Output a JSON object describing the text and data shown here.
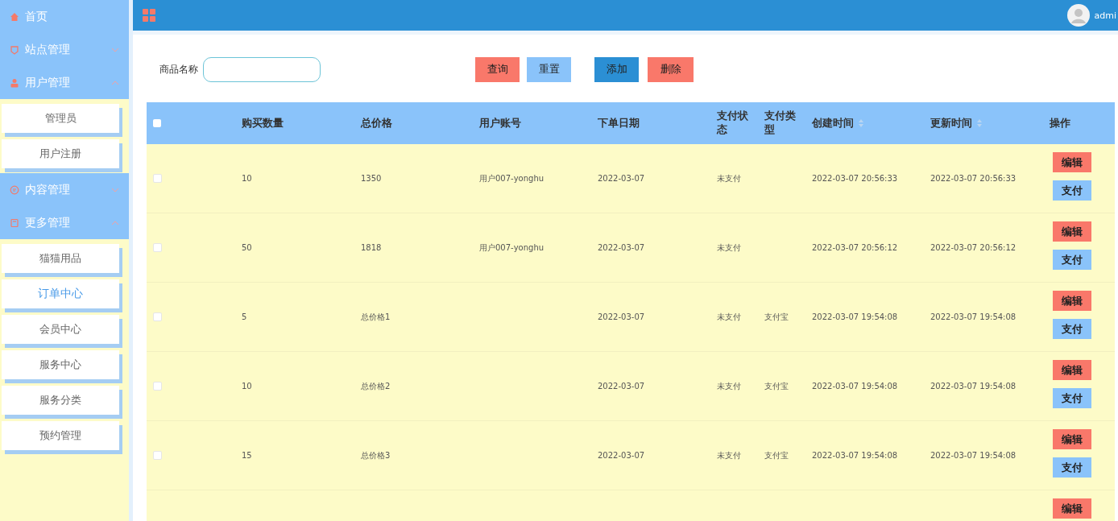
{
  "sidebar": {
    "items": [
      {
        "label": "首页"
      },
      {
        "label": "站点管理",
        "expanded": false
      },
      {
        "label": "用户管理",
        "expanded": true,
        "children": [
          {
            "label": "管理员",
            "selected": false
          },
          {
            "label": "用户注册",
            "selected": false
          }
        ]
      },
      {
        "label": "内容管理",
        "expanded": false
      },
      {
        "label": "更多管理",
        "expanded": true,
        "children": [
          {
            "label": "猫猫用品",
            "selected": false
          },
          {
            "label": "订单中心",
            "selected": true
          },
          {
            "label": "会员中心",
            "selected": false
          },
          {
            "label": "服务中心",
            "selected": false
          },
          {
            "label": "服务分类",
            "selected": false
          },
          {
            "label": "预约管理",
            "selected": false
          }
        ]
      }
    ]
  },
  "topbar": {
    "user": "admi"
  },
  "search": {
    "label": "商品名称",
    "buttons": [
      {
        "label": "查询",
        "kind": "query"
      },
      {
        "label": "重置",
        "kind": "reset"
      },
      {
        "label": "添加",
        "kind": "add"
      },
      {
        "label": "删除",
        "kind": "delete"
      }
    ]
  },
  "table": {
    "all_checked": false,
    "columns": [
      {
        "label": "购买数量"
      },
      {
        "label": "总价格"
      },
      {
        "label": "用户账号"
      },
      {
        "label": "下单日期"
      },
      {
        "label": "支付状态"
      },
      {
        "label": "支付类型"
      },
      {
        "label": "创建时间",
        "sortable": true
      },
      {
        "label": "更新时间",
        "sortable": true
      },
      {
        "label": "操作"
      }
    ],
    "rows": [
      {
        "checked": false,
        "cells": [
          "10",
          "1350",
          "用户007-yonghu",
          "2022-03-07",
          "未支付",
          "",
          "2022-03-07 20:56:33",
          "2022-03-07 20:56:33"
        ],
        "actions": [
          {
            "label": "编辑",
            "kind": "edit"
          },
          {
            "label": "支付",
            "kind": "pay"
          }
        ]
      },
      {
        "checked": false,
        "cells": [
          "50",
          "1818",
          "用户007-yonghu",
          "2022-03-07",
          "未支付",
          "",
          "2022-03-07 20:56:12",
          "2022-03-07 20:56:12"
        ],
        "actions": [
          {
            "label": "编辑",
            "kind": "edit"
          },
          {
            "label": "支付",
            "kind": "pay"
          }
        ]
      },
      {
        "checked": false,
        "cells": [
          "5",
          "总价格1",
          "",
          "2022-03-07",
          "未支付",
          "支付宝",
          "2022-03-07 19:54:08",
          "2022-03-07 19:54:08"
        ],
        "actions": [
          {
            "label": "编辑",
            "kind": "edit"
          },
          {
            "label": "支付",
            "kind": "pay"
          }
        ]
      },
      {
        "checked": false,
        "cells": [
          "10",
          "总价格2",
          "",
          "2022-03-07",
          "未支付",
          "支付宝",
          "2022-03-07 19:54:08",
          "2022-03-07 19:54:08"
        ],
        "actions": [
          {
            "label": "编辑",
            "kind": "edit"
          },
          {
            "label": "支付",
            "kind": "pay"
          }
        ]
      },
      {
        "checked": false,
        "cells": [
          "15",
          "总价格3",
          "",
          "2022-03-07",
          "未支付",
          "支付宝",
          "2022-03-07 19:54:08",
          "2022-03-07 19:54:08"
        ],
        "actions": [
          {
            "label": "编辑",
            "kind": "edit"
          },
          {
            "label": "支付",
            "kind": "pay"
          }
        ]
      },
      {
        "cells": [],
        "actions": [
          {
            "label": "编辑",
            "kind": "edit"
          }
        ]
      }
    ]
  }
}
